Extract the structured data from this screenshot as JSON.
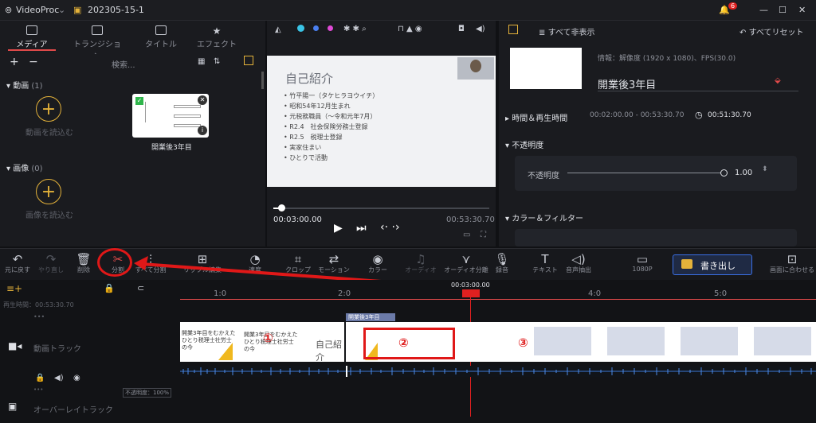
{
  "title_bar": {
    "app": "VideoProc",
    "project": "202305-15-1",
    "badge": "6"
  },
  "media_tabs": [
    {
      "label": "メディア"
    },
    {
      "label": "トランジション"
    },
    {
      "label": "タイトル"
    },
    {
      "label": "エフェクト"
    }
  ],
  "search_placeholder": "検索...",
  "groups": {
    "video_label": "動画",
    "video_count": "(1)",
    "video_add": "動画を読込む",
    "image_label": "画像",
    "image_count": "(0)",
    "image_add": "画像を読込む"
  },
  "media_item": {
    "name": "開業後3年目"
  },
  "slide": {
    "title": "自己紹介",
    "lines": [
      "• 竹平陽一（タケヒラヨウイチ）",
      "• 昭和54年12月生まれ",
      "• 元税務職員（〜令和元年7月）",
      "• R2.4　社会保険労務士登録",
      "• R2.5　税理士登録",
      "• 実家住まい",
      "• ひとりで活動"
    ]
  },
  "player": {
    "current": "00:03:00.00",
    "total": "00:53:30.70"
  },
  "right_panel": {
    "hide_all": "すべて非表示",
    "reset_all": "すべてリセット",
    "info": "情報：解像度 (1920 x 1080)、FPS(30.0)",
    "clip_name": "開業後3年目",
    "time_section": "時間＆再生時間",
    "time_range": "00:02:00.00 - 00:53:30.70",
    "duration": "00:51:30.70",
    "opacity_section": "不透明度",
    "opacity_label": "不透明度",
    "opacity_value": "1.00",
    "color_section": "カラー＆フィルター"
  },
  "toolbar": [
    {
      "label": "元に戻す",
      "icon": "undo-icon"
    },
    {
      "label": "やり直し",
      "icon": "redo-icon"
    },
    {
      "label": "削除",
      "icon": "trash-icon"
    },
    {
      "label": "分割",
      "icon": "scissors-icon"
    },
    {
      "label": "すべて分割",
      "icon": "split-all-icon"
    },
    {
      "label": "リップル編集",
      "icon": "ripple-icon"
    },
    {
      "label": "速度",
      "icon": "speed-icon"
    },
    {
      "label": "クロップ",
      "icon": "crop-icon"
    },
    {
      "label": "モーション",
      "icon": "motion-icon"
    },
    {
      "label": "カラー",
      "icon": "palette-icon"
    },
    {
      "label": "オーディオ",
      "icon": "audio-icon"
    },
    {
      "label": "オーディオ分離",
      "icon": "audio-split-icon"
    },
    {
      "label": "録音",
      "icon": "mic-icon"
    },
    {
      "label": "テキスト",
      "icon": "text-icon"
    },
    {
      "label": "音声抽出",
      "icon": "extract-icon"
    },
    {
      "label": "1080P",
      "icon": "resolution-icon"
    },
    {
      "label": "画面に合わせる",
      "icon": "fit-icon"
    }
  ],
  "export_label": "書き出し",
  "timeline": {
    "playhead": "00:03:00.00",
    "ruler": [
      "1:0",
      "2:0",
      "4:0",
      "5:0"
    ],
    "total": "00:53:30.70",
    "total_label": "再生時間",
    "video_track": "動画トラック",
    "overlay_track": "オーバーレイトラック",
    "opacity_tag": "不透明度：100%",
    "clip_label": "開業後3年目",
    "clip1_text": "開業3年目をむかえた\nひとり税理士社労士\nの今",
    "clip2_text": "開業3年目をむかえた\nひとり税理士社労士\nの今",
    "clip3_text": "自己紹介"
  },
  "annotations": [
    "①",
    "②",
    "③"
  ],
  "colors": {
    "accent": "#e04a4a",
    "orange": "#e4b23a",
    "export": "#3a6fe6"
  }
}
